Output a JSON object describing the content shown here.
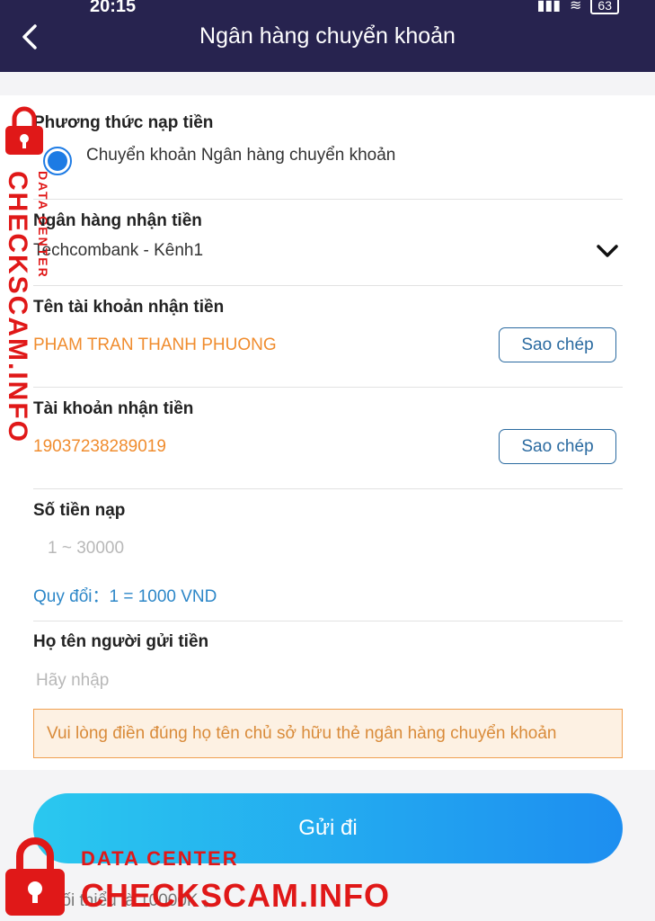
{
  "status_bar": {
    "time": "20:15",
    "battery": "63"
  },
  "header": {
    "title": "Ngân hàng chuyển khoản"
  },
  "method": {
    "label": "Phương thức nạp tiền",
    "option": "Chuyển khoản Ngân hàng chuyển khoản"
  },
  "bank": {
    "label": "Ngân hàng nhận tiền",
    "value": "Techcombank - Kênh1"
  },
  "account_name": {
    "label": "Tên tài khoản nhận tiền",
    "value": "PHAM TRAN THANH PHUONG",
    "copy_label": "Sao chép"
  },
  "account_number": {
    "label": "Tài khoản nhận tiền",
    "value": "19037238289019",
    "copy_label": "Sao chép"
  },
  "amount": {
    "label": "Số tiền nạp",
    "placeholder": "1 ~ 30000",
    "rate": "Quy đổi：1 = 1000 VND"
  },
  "sender": {
    "label": "Họ tên người gửi tiền",
    "placeholder": "Hãy nhập",
    "notice": "Vui lòng điền đúng họ tên chủ sở hữu thẻ ngân hàng chuyển khoản"
  },
  "submit_label": "Gửi đi",
  "footnote": "※ Tối thiểu là 10000K 。",
  "watermark": {
    "vertical": "CHECKSCAM.INFO",
    "vertical_small": "DATA CENTER",
    "bottom_small": "DATA CENTER",
    "bottom_large": "CHECKSCAM.INFO"
  },
  "colors": {
    "header_bg": "#27234f",
    "accent_blue": "#1d7be4",
    "orange": "#f08c2e",
    "watermark_red": "#e01818"
  }
}
